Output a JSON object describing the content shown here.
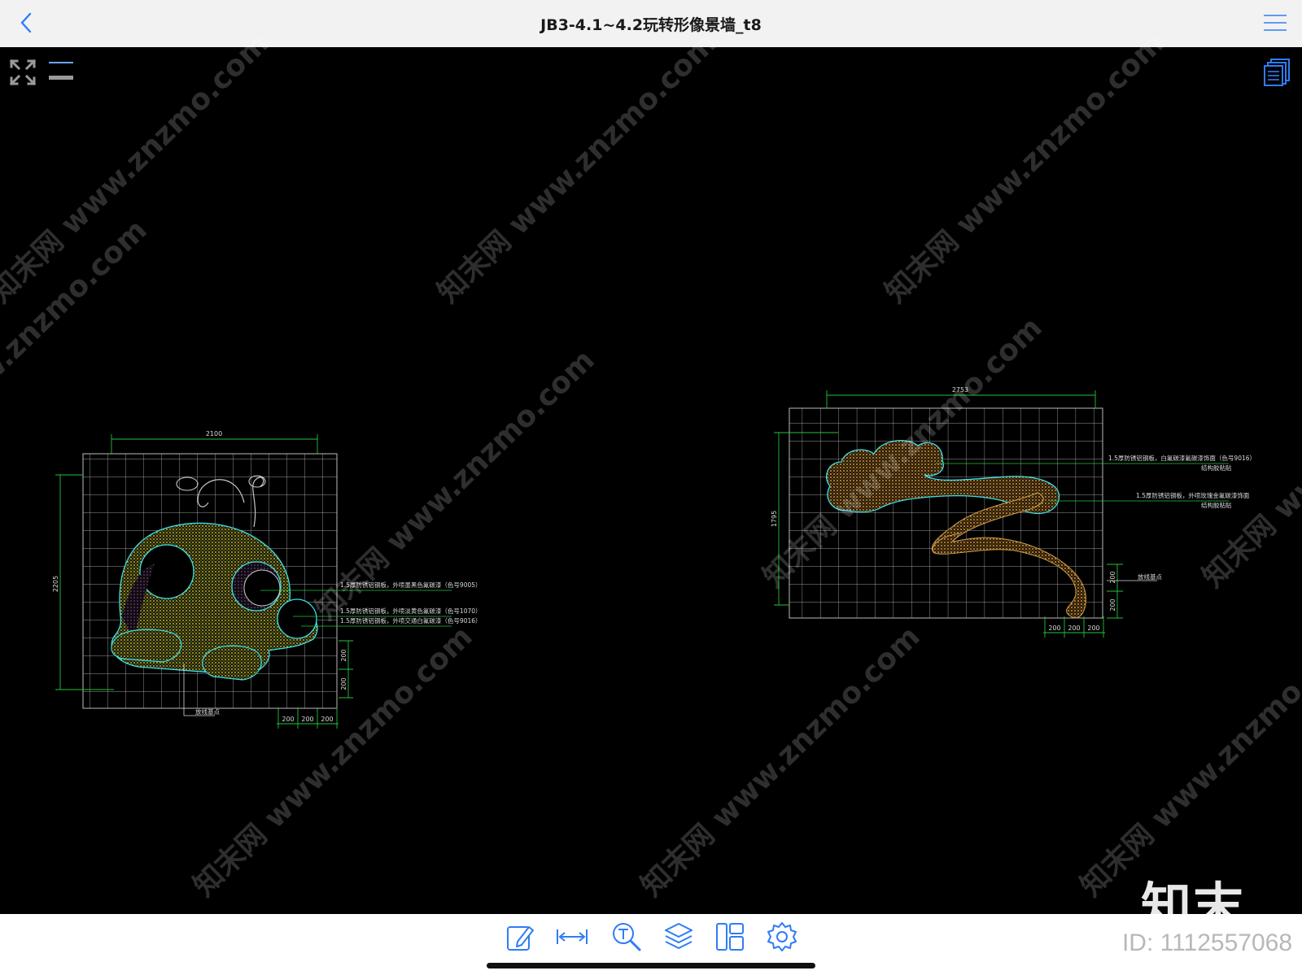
{
  "header": {
    "title": "JB3-4.1~4.2玩转形像景墙_t8"
  },
  "drawing1": {
    "dim_top": "2100",
    "dim_left": "2205",
    "dim_bottom": [
      "200",
      "200",
      "200"
    ],
    "dim_right": [
      "200",
      "200"
    ],
    "notes": [
      "1.5厚防锈铝钢板，外喷墨黑色氟碳漆（色号9005）",
      "1.5厚防锈铝钢板，外喷淡黄色氟碳漆（色号1070）",
      "1.5厚防锈铝钢板，外喷交通白氟碳漆（色号9016）"
    ],
    "base_label": "放线基点"
  },
  "drawing2": {
    "dim_top": "2753",
    "dim_left": "1795",
    "dim_bottom": [
      "200",
      "200",
      "200"
    ],
    "dim_right": [
      "200",
      "200"
    ],
    "notes": [
      [
        "1.5厚防锈铝钢板，白氟碳漆氟碳漆饰面（色号9016）",
        "结构胶粘贴"
      ],
      [
        "1.5厚防锈铝钢板，外喷玫瑰金氟碳漆饰面",
        "结构胶粘贴"
      ]
    ],
    "base_label": "放线基点"
  },
  "watermark": {
    "text": "知末网 www.znzmo.com"
  },
  "brand": {
    "logo": "知末",
    "id": "ID: 1112557068"
  },
  "colors": {
    "accent": "#2f7cf6",
    "cad_grid": "#d9d9d9",
    "dim_green": "#22c43a",
    "cyan": "#3ee0ea",
    "yellow": "#e8d23a",
    "brown": "#b98a3a"
  }
}
